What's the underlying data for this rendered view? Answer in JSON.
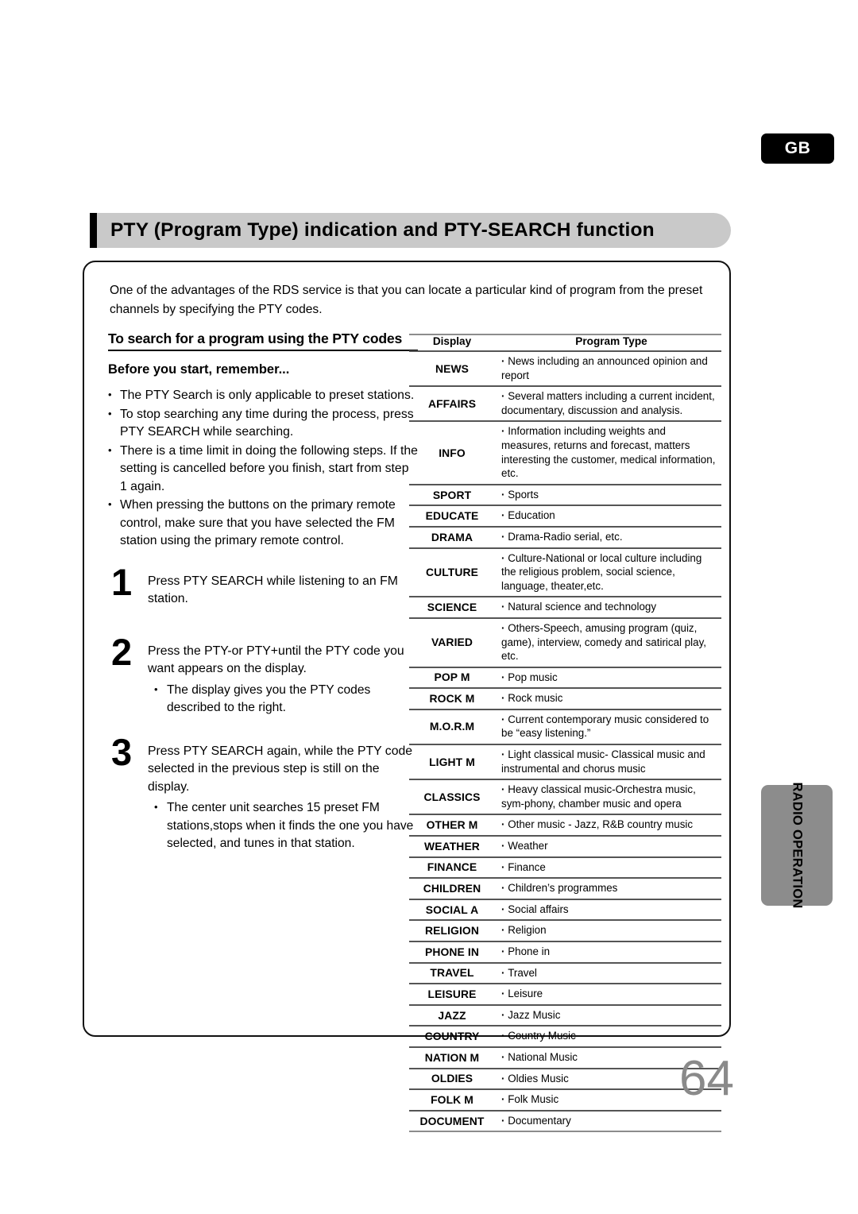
{
  "region_badge": "GB",
  "header": {
    "title": "PTY (Program Type) indication and PTY-SEARCH function"
  },
  "intro": "One  of the advantages of the RDS service is that you can locate a particular kind of program from the preset channels by specifying the PTY codes.",
  "left_column": {
    "subheading": "To search for a program using the PTY codes",
    "before_you_start": "Before you start, remember...",
    "notes": [
      "The PTY Search is only applicable to preset stations.",
      "To stop searching any time during the process, press PTY SEARCH while searching.",
      "There is a time limit in doing the following steps. If the setting is cancelled before you finish, start from step 1 again.",
      "When pressing the buttons on the primary remote control, make sure that you have selected the FM station using the primary remote control."
    ],
    "steps": [
      {
        "number": "1",
        "text": "Press PTY SEARCH while listening to an FM station.",
        "subnotes": []
      },
      {
        "number": "2",
        "text": "Press the PTY-or PTY+until the PTY code you want appears on the display.",
        "subnotes": [
          "The display gives you the PTY codes described to the right."
        ]
      },
      {
        "number": "3",
        "text": "Press PTY SEARCH again, while the PTY code selected in the previous step is still on the display.",
        "subnotes": [
          "The center unit searches 15 preset FM stations,stops when it finds the one you have selected, and tunes in that station."
        ]
      }
    ]
  },
  "pty_table": {
    "columns": [
      "Display",
      "Program Type"
    ],
    "rows": [
      {
        "display": "NEWS",
        "description": "News including an announced opinion and report"
      },
      {
        "display": "AFFAIRS",
        "description": "Several matters including a current incident, documentary, discussion and analysis."
      },
      {
        "display": "INFO",
        "description": "Information including weights and measures, returns and forecast, matters interesting the customer, medical information, etc."
      },
      {
        "display": "SPORT",
        "description": "Sports"
      },
      {
        "display": "EDUCATE",
        "description": "Education"
      },
      {
        "display": "DRAMA",
        "description": "Drama-Radio serial, etc."
      },
      {
        "display": "CULTURE",
        "description": "Culture-National or local culture including the religious problem, social science, language, theater,etc."
      },
      {
        "display": "SCIENCE",
        "description": "Natural science and technology"
      },
      {
        "display": "VARIED",
        "description": "Others-Speech, amusing program (quiz, game), interview, comedy and satirical play, etc."
      },
      {
        "display": "POP M",
        "description": "Pop music"
      },
      {
        "display": "ROCK M",
        "description": "Rock music"
      },
      {
        "display": "M.O.R.M",
        "description": "Current contemporary music considered to be “easy listening.”"
      },
      {
        "display": "LIGHT M",
        "description": "Light classical music- Classical music and instrumental and chorus music"
      },
      {
        "display": "CLASSICS",
        "description": "Heavy classical  music-Orchestra music, sym-phony, chamber music and opera"
      },
      {
        "display": "OTHER M",
        "description": "Other music - Jazz, R&B country music"
      },
      {
        "display": "WEATHER",
        "description": "Weather"
      },
      {
        "display": "FINANCE",
        "description": "Finance"
      },
      {
        "display": "CHILDREN",
        "description": "Children’s programmes"
      },
      {
        "display": "SOCIAL A",
        "description": "Social affairs"
      },
      {
        "display": "RELIGION",
        "description": "Religion"
      },
      {
        "display": "PHONE IN",
        "description": "Phone in"
      },
      {
        "display": "TRAVEL",
        "description": "Travel"
      },
      {
        "display": "LEISURE",
        "description": "Leisure"
      },
      {
        "display": "JAZZ",
        "description": "Jazz Music"
      },
      {
        "display": "COUNTRY",
        "description": "Country Music"
      },
      {
        "display": "NATION M",
        "description": "National Music"
      },
      {
        "display": "OLDIES",
        "description": "Oldies Music"
      },
      {
        "display": "FOLK M",
        "description": "Folk Music"
      },
      {
        "display": "DOCUMENT",
        "description": "Documentary"
      }
    ]
  },
  "side_tab": "RADIO OPERATION",
  "page_number": "64"
}
